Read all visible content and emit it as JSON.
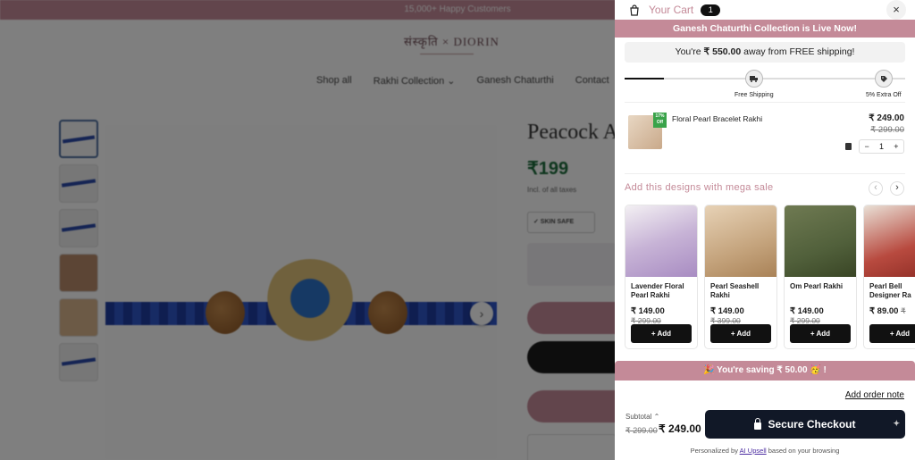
{
  "background": {
    "announcement": "15,000+ Happy Customers",
    "logo": "संस्कृति × DIORIN",
    "nav": [
      "Shop all",
      "Rakhi Collection ⌄",
      "Ganesh Chaturthi",
      "Contact"
    ],
    "product_title": "Peacock A",
    "product_price": "₹199",
    "tax_note": "Incl. of all taxes",
    "badge": "✓ SKIN SAFE"
  },
  "cart": {
    "title": "Your Cart",
    "count": "1",
    "close_symbol": "×",
    "promo_banner": "Ganesh Chaturthi Collection is Live Now!",
    "shipping": {
      "prefix": "You're",
      "amount": "₹ 550.00",
      "suffix": "away from FREE shipping!",
      "progress_fraction": 0.14,
      "milestones": [
        {
          "label": "Free Shipping",
          "icon": "truck-icon"
        },
        {
          "label": "5% Extra Off",
          "icon": "tag-icon"
        }
      ]
    },
    "item": {
      "name": "Floral Pearl Bracelet Rakhi",
      "badge": "17% Off",
      "price": "₹ 249.00",
      "compare_price": "₹ 299.00",
      "qty_minus": "−",
      "quantity": "1",
      "qty_plus": "+"
    },
    "upsell": {
      "title": "Add this designs with mega sale",
      "prev_symbol": "‹",
      "next_symbol": "›",
      "add_label": "+ Add",
      "products": [
        {
          "name": "Lavender Floral Pearl Rakhi",
          "price": "₹ 149.00",
          "compare": "₹ 299.00"
        },
        {
          "name": "Pearl Seashell Rakhi",
          "price": "₹ 149.00",
          "compare": "₹ 399.00"
        },
        {
          "name": "Om Pearl Rakhi",
          "price": "₹ 149.00",
          "compare": "₹ 299.00"
        },
        {
          "name": "Pearl Bell Designer Ra",
          "price": "₹ 89.00",
          "compare": "₹"
        }
      ]
    },
    "saving_banner": "🎉 You're saving ₹ 50.00 🥳 !",
    "order_note": "Add order note",
    "subtotal_label": "Subtotal ⌃",
    "subtotal_compare": "₹ 299.00",
    "subtotal_price": "₹ 249.00",
    "checkout_label": "Secure Checkout",
    "footer": {
      "prefix": "Personalized by",
      "link": "AI Upsell",
      "suffix": "based on your browsing"
    }
  },
  "colors": {
    "brand_pink": "#c48a98",
    "checkout_dark": "#111827",
    "price_green": "#1b6b3a"
  }
}
